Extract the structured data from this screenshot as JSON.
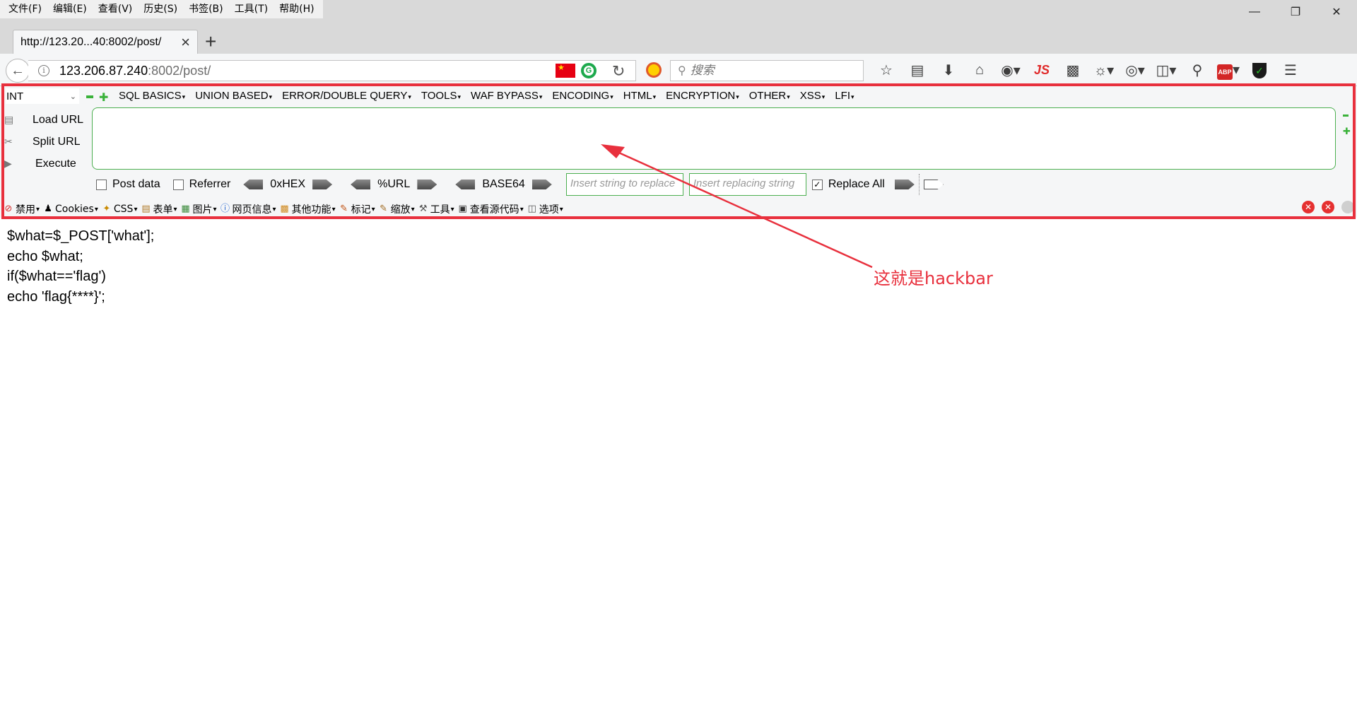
{
  "menubar": {
    "items": [
      "文件(F)",
      "编辑(E)",
      "查看(V)",
      "历史(S)",
      "书签(B)",
      "工具(T)",
      "帮助(H)"
    ]
  },
  "tab": {
    "title": "http://123.20...40:8002/post/"
  },
  "navbar": {
    "url_host": "123.206.87.240",
    "url_rest": ":8002/post/",
    "search_placeholder": "搜索",
    "js_label": "JS",
    "abp_label": "ABP"
  },
  "hackbar": {
    "select_value": "INT",
    "menus": [
      "SQL BASICS",
      "UNION BASED",
      "ERROR/DOUBLE QUERY",
      "TOOLS",
      "WAF BYPASS",
      "ENCODING",
      "HTML",
      "ENCRYPTION",
      "OTHER",
      "XSS",
      "LFI"
    ],
    "actions": {
      "load_url": "Load URL",
      "split_url": "Split URL",
      "execute": "Execute"
    },
    "options": {
      "post_data": "Post data",
      "referrer": "Referrer",
      "hex": "0xHEX",
      "url": "%URL",
      "base64": "BASE64",
      "insert_placeholder": "Insert string to replace",
      "replacing_placeholder": "Insert replacing string",
      "replace_all": "Replace All"
    },
    "post_data_checked": false,
    "referrer_checked": false,
    "replace_all_checked": true
  },
  "webdev": {
    "items": [
      "禁用",
      "Cookies",
      "CSS",
      "表单",
      "图片",
      "网页信息",
      "其他功能",
      "标记",
      "缩放",
      "工具",
      "查看源代码",
      "选项"
    ]
  },
  "page": {
    "code_lines": [
      "$what=$_POST['what'];",
      "echo $what;",
      "if($what=='flag')",
      "echo 'flag{****}';"
    ]
  },
  "annotation": {
    "text": "这就是hackbar",
    "color": "#e8303d"
  },
  "colors": {
    "highlight": "#e8303d",
    "hackbar_green": "#4caf50"
  }
}
